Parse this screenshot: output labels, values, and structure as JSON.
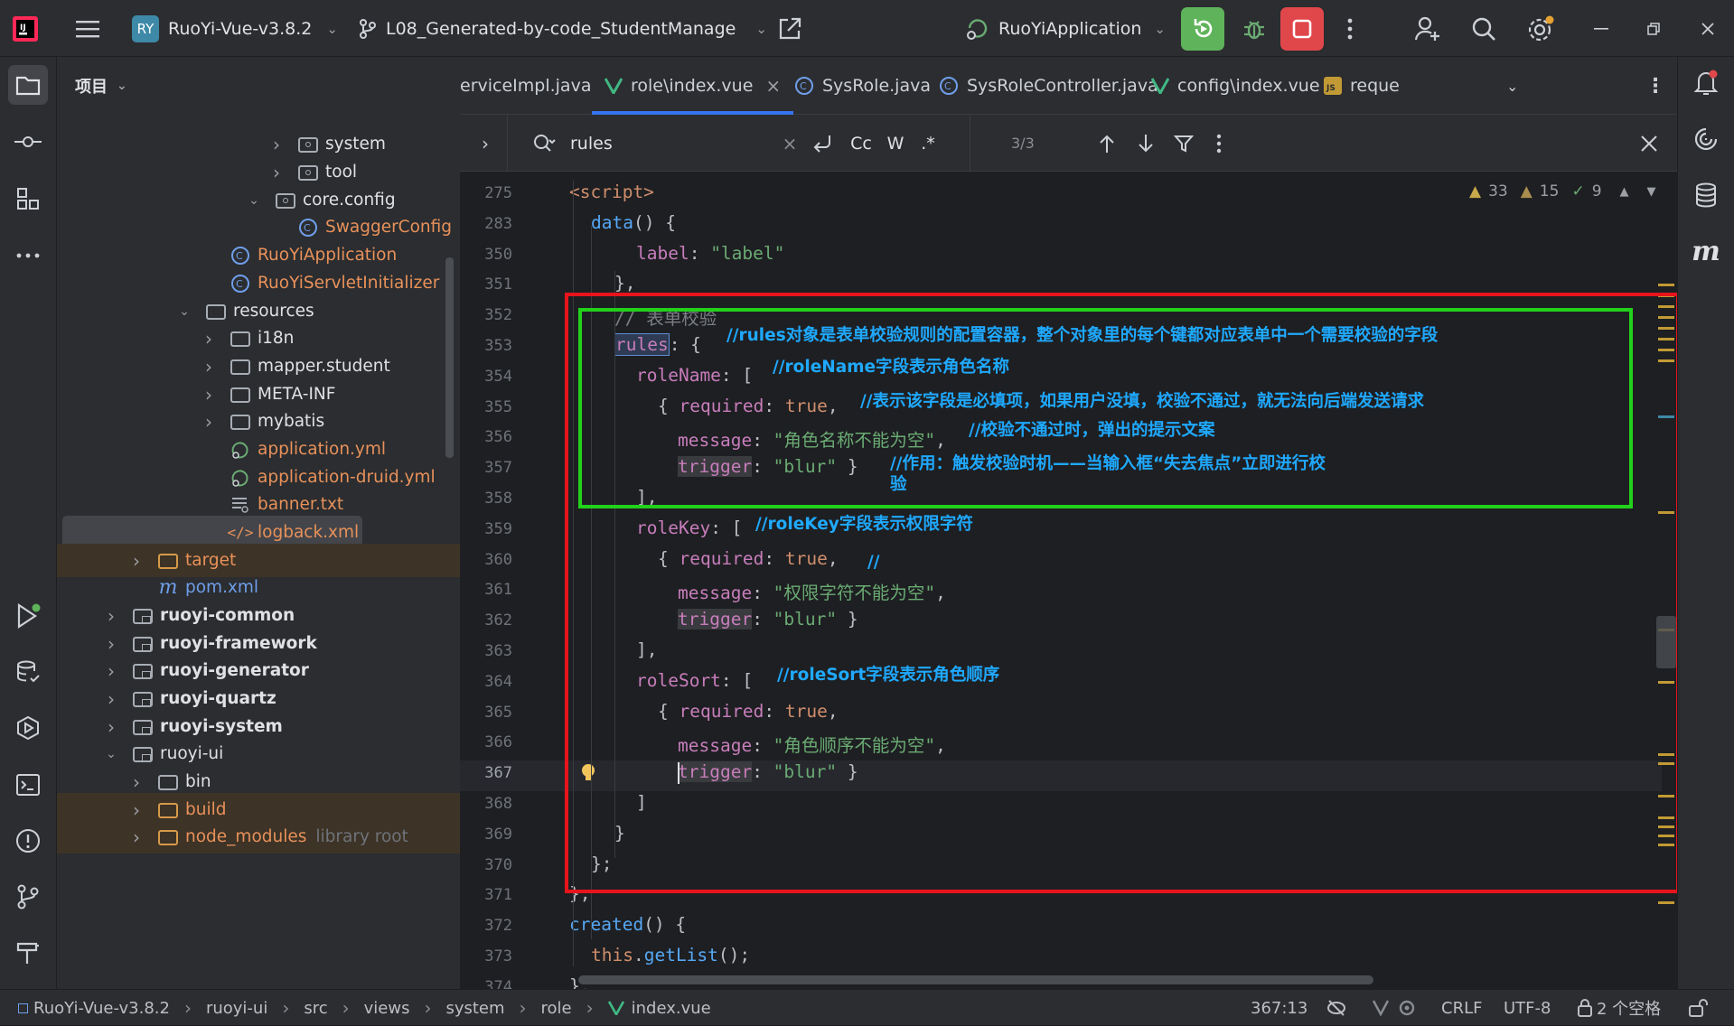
{
  "titlebar": {
    "project_badge": "RY",
    "project_name": "RuoYi-Vue-v3.8.2",
    "branch": "L08_Generated-by-code_StudentManage",
    "run_config": "RuoYiApplication"
  },
  "project_panel": {
    "title": "项目",
    "tree": [
      {
        "label": "system",
        "kind": "package",
        "expand": "collapsed",
        "indent": 3
      },
      {
        "label": "tool",
        "kind": "package",
        "expand": "collapsed",
        "indent": 3
      },
      {
        "label": "core.config",
        "kind": "package",
        "expand": "expanded",
        "indent": 2
      },
      {
        "label": "SwaggerConfig",
        "kind": "class",
        "expand": "none",
        "indent": 3
      },
      {
        "label": "RuoYiApplication",
        "kind": "class",
        "expand": "none",
        "indent": 1
      },
      {
        "label": "RuoYiServletInitializer",
        "kind": "class",
        "expand": "none",
        "indent": 1
      },
      {
        "label": "resources",
        "kind": "folder",
        "expand": "expanded",
        "indent": 0
      },
      {
        "label": "i18n",
        "kind": "folder",
        "expand": "collapsed",
        "indent": 1
      },
      {
        "label": "mapper.student",
        "kind": "folder",
        "expand": "collapsed",
        "indent": 1
      },
      {
        "label": "META-INF",
        "kind": "folder",
        "expand": "collapsed",
        "indent": 1
      },
      {
        "label": "mybatis",
        "kind": "folder",
        "expand": "collapsed",
        "indent": 1
      },
      {
        "label": "application.yml",
        "kind": "yml",
        "expand": "none",
        "indent": 1
      },
      {
        "label": "application-druid.yml",
        "kind": "yml",
        "expand": "none",
        "indent": 1
      },
      {
        "label": "banner.txt",
        "kind": "txt",
        "expand": "none",
        "indent": 1
      },
      {
        "label": "logback.xml",
        "kind": "xml",
        "expand": "none",
        "indent": 1,
        "selected": true
      },
      {
        "label": "target",
        "kind": "folder-orange",
        "expand": "collapsed",
        "indent": -1,
        "excluded": true
      },
      {
        "label": "pom.xml",
        "kind": "maven",
        "expand": "none",
        "indent": -1
      },
      {
        "label": "ruoyi-common",
        "kind": "module",
        "expand": "collapsed",
        "indent": -2
      },
      {
        "label": "ruoyi-framework",
        "kind": "module",
        "expand": "collapsed",
        "indent": -2
      },
      {
        "label": "ruoyi-generator",
        "kind": "module",
        "expand": "collapsed",
        "indent": -2
      },
      {
        "label": "ruoyi-quartz",
        "kind": "module",
        "expand": "collapsed",
        "indent": -2
      },
      {
        "label": "ruoyi-system",
        "kind": "module",
        "expand": "collapsed",
        "indent": -2
      },
      {
        "label": "ruoyi-ui",
        "kind": "module-plain",
        "expand": "expanded",
        "indent": -2
      },
      {
        "label": "bin",
        "kind": "folder",
        "expand": "collapsed",
        "indent": -1
      },
      {
        "label": "build",
        "kind": "folder-orange",
        "expand": "collapsed",
        "indent": -1,
        "excluded": true
      },
      {
        "label": "node_modules",
        "suffix": "library root",
        "kind": "folder-orange",
        "expand": "collapsed",
        "indent": -1,
        "excluded": true
      }
    ]
  },
  "tabs": [
    {
      "label": "erviceImpl.java",
      "icon": "java-class-icon"
    },
    {
      "label": "role\\index.vue",
      "icon": "vue-icon",
      "active": true
    },
    {
      "label": "SysRole.java",
      "icon": "java-class-icon"
    },
    {
      "label": "SysRoleController.java",
      "icon": "java-class-icon"
    },
    {
      "label": "config\\index.vue",
      "icon": "vue-icon"
    },
    {
      "label": "reque",
      "icon": "js-icon"
    }
  ],
  "find": {
    "query": "rules",
    "match_case": "Cc",
    "words": "W",
    "regex": ".*",
    "count": "3/3"
  },
  "inspections": {
    "warnings": "33",
    "weak_warnings": "15",
    "ok": "9"
  },
  "code_lines": [
    {
      "n": "275",
      "segs": [
        [
          "k",
          "<script>"
        ]
      ],
      "indent": 0
    },
    {
      "n": "283",
      "segs": [
        [
          "f",
          "data"
        ],
        [
          "w",
          "() {"
        ]
      ],
      "indent": 1
    },
    {
      "n": "350",
      "segs": [
        [
          "p",
          "label"
        ],
        [
          "w",
          ": "
        ],
        [
          "s",
          "\"label\""
        ]
      ],
      "indent": 3
    },
    {
      "n": "351",
      "segs": [
        [
          "w",
          "},"
        ]
      ],
      "indent": 2
    },
    {
      "n": "352",
      "segs": [
        [
          "c",
          "// 表单校验"
        ]
      ],
      "indent": 2
    },
    {
      "n": "353",
      "segs": [
        [
          "p",
          "rules"
        ],
        [
          "w",
          ": {"
        ]
      ],
      "indent": 2
    },
    {
      "n": "354",
      "segs": [
        [
          "p",
          "roleName"
        ],
        [
          "w",
          ": ["
        ]
      ],
      "indent": 3
    },
    {
      "n": "355",
      "segs": [
        [
          "w",
          "{ "
        ],
        [
          "p",
          "required"
        ],
        [
          "w",
          ": "
        ],
        [
          "k",
          "true"
        ],
        [
          "w",
          ","
        ]
      ],
      "indent": 4
    },
    {
      "n": "356",
      "segs": [
        [
          "p",
          "message"
        ],
        [
          "w",
          ": "
        ],
        [
          "s",
          "\"角色名称不能为空\""
        ],
        [
          "w",
          ","
        ]
      ],
      "indent": 5
    },
    {
      "n": "357",
      "segs": [
        [
          "p",
          "trigger"
        ],
        [
          "w",
          ": "
        ],
        [
          "s",
          "\"blur\""
        ],
        [
          "w",
          " }"
        ]
      ],
      "indent": 5
    },
    {
      "n": "358",
      "segs": [
        [
          "w",
          "],"
        ]
      ],
      "indent": 3
    },
    {
      "n": "359",
      "segs": [
        [
          "p",
          "roleKey"
        ],
        [
          "w",
          ": ["
        ]
      ],
      "indent": 3
    },
    {
      "n": "360",
      "segs": [
        [
          "w",
          "{ "
        ],
        [
          "p",
          "required"
        ],
        [
          "w",
          ": "
        ],
        [
          "k",
          "true"
        ],
        [
          "w",
          ","
        ]
      ],
      "indent": 4
    },
    {
      "n": "361",
      "segs": [
        [
          "p",
          "message"
        ],
        [
          "w",
          ": "
        ],
        [
          "s",
          "\"权限字符不能为空\""
        ],
        [
          "w",
          ","
        ]
      ],
      "indent": 5
    },
    {
      "n": "362",
      "segs": [
        [
          "p",
          "trigger"
        ],
        [
          "w",
          ": "
        ],
        [
          "s",
          "\"blur\""
        ],
        [
          "w",
          " }"
        ]
      ],
      "indent": 5
    },
    {
      "n": "363",
      "segs": [
        [
          "w",
          "],"
        ]
      ],
      "indent": 3
    },
    {
      "n": "364",
      "segs": [
        [
          "p",
          "roleSort"
        ],
        [
          "w",
          ": ["
        ]
      ],
      "indent": 3
    },
    {
      "n": "365",
      "segs": [
        [
          "w",
          "{ "
        ],
        [
          "p",
          "required"
        ],
        [
          "w",
          ": "
        ],
        [
          "k",
          "true"
        ],
        [
          "w",
          ","
        ]
      ],
      "indent": 4
    },
    {
      "n": "366",
      "segs": [
        [
          "p",
          "message"
        ],
        [
          "w",
          ": "
        ],
        [
          "s",
          "\"角色顺序不能为空\""
        ],
        [
          "w",
          ","
        ]
      ],
      "indent": 5
    },
    {
      "n": "367",
      "segs": [
        [
          "p",
          "trigger"
        ],
        [
          "w",
          ": "
        ],
        [
          "s",
          "\"blur\""
        ],
        [
          "w",
          " }"
        ]
      ],
      "indent": 5,
      "current": true
    },
    {
      "n": "368",
      "segs": [
        [
          "w",
          "]"
        ]
      ],
      "indent": 3
    },
    {
      "n": "369",
      "segs": [
        [
          "w",
          "}"
        ]
      ],
      "indent": 2
    },
    {
      "n": "370",
      "segs": [
        [
          "w",
          "};"
        ]
      ],
      "indent": 1
    },
    {
      "n": "371",
      "segs": [
        [
          "w",
          "},"
        ]
      ],
      "indent": 0
    },
    {
      "n": "372",
      "segs": [
        [
          "f",
          "created"
        ],
        [
          "w",
          "() {"
        ]
      ],
      "indent": 0
    },
    {
      "n": "373",
      "segs": [
        [
          "k",
          "this"
        ],
        [
          "w",
          "."
        ],
        [
          "f",
          "getList"
        ],
        [
          "w",
          "();"
        ]
      ],
      "indent": 1
    },
    {
      "n": "374",
      "segs": [
        [
          "w",
          "},"
        ]
      ],
      "indent": 0
    }
  ],
  "annotations": {
    "rules": "//rules对象是表单校验规则的配置容器，整个对象里的每个键都对应表单中一个需要校验的字段",
    "roleName": "//roleName字段表示角色名称",
    "required": "//表示该字段是必填项，如果用户没填，校验不通过，就无法向后端发送请求",
    "message": "//校验不通过时，弹出的提示文案",
    "trigger_1": "//作用：触发校验时机——当输入框“失去焦点”立即进行校",
    "trigger_2": "验",
    "roleKey": "//roleKey字段表示权限字符",
    "stray": "//",
    "roleSort": "//roleSort字段表示角色顺序"
  },
  "statusbar": {
    "breadcrumbs": [
      "RuoYi-Vue-v3.8.2",
      "ruoyi-ui",
      "src",
      "views",
      "system",
      "role",
      "index.vue"
    ],
    "position": "367:13",
    "line_sep": "CRLF",
    "encoding": "UTF-8",
    "indent": "2 个空格"
  },
  "colors": {
    "red_box": "#e8141c",
    "green_box": "#22d11b",
    "annotation": "#1fa9ff"
  }
}
